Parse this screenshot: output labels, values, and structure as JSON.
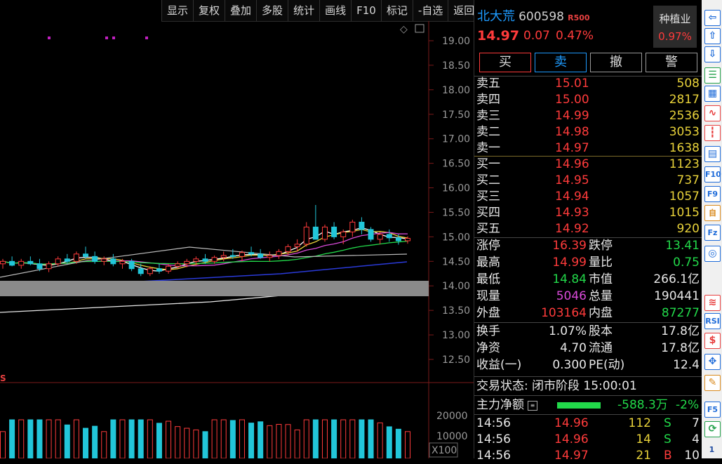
{
  "toolbar": {
    "items": [
      "显示",
      "复权",
      "叠加",
      "多股",
      "统计",
      "画线",
      "F10",
      "标记",
      "-自选",
      "返回"
    ]
  },
  "chart": {
    "y_ticks": [
      "19.00",
      "18.50",
      "18.00",
      "17.50",
      "17.00",
      "16.50",
      "16.00",
      "15.50",
      "15.00",
      "14.50",
      "14.00",
      "13.50",
      "13.00",
      "12.50"
    ],
    "vol_ticks": [
      "20000",
      "10000"
    ],
    "vol_unit": "X100",
    "s_marker": "S"
  },
  "chart_data": {
    "type": "candlestick",
    "price_range": [
      12.5,
      19.0
    ],
    "volume_range": [
      0,
      25000
    ],
    "candles": [
      [
        14.45,
        14.55,
        14.35,
        14.5
      ],
      [
        14.5,
        14.6,
        14.4,
        14.42
      ],
      [
        14.42,
        14.55,
        14.35,
        14.5
      ],
      [
        14.5,
        14.6,
        14.42,
        14.45
      ],
      [
        14.45,
        14.55,
        14.3,
        14.35
      ],
      [
        14.35,
        14.5,
        14.28,
        14.45
      ],
      [
        14.45,
        14.6,
        14.4,
        14.55
      ],
      [
        14.55,
        14.65,
        14.45,
        14.5
      ],
      [
        14.5,
        14.7,
        14.45,
        14.65
      ],
      [
        14.65,
        14.8,
        14.55,
        14.6
      ],
      [
        14.6,
        14.7,
        14.45,
        14.5
      ],
      [
        14.5,
        14.6,
        14.42,
        14.55
      ],
      [
        14.55,
        14.65,
        14.4,
        14.45
      ],
      [
        14.45,
        14.55,
        14.35,
        14.5
      ],
      [
        14.5,
        14.55,
        14.3,
        14.35
      ],
      [
        14.35,
        14.45,
        14.2,
        14.25
      ],
      [
        14.25,
        14.4,
        14.2,
        14.35
      ],
      [
        14.35,
        14.45,
        14.25,
        14.3
      ],
      [
        14.3,
        14.45,
        14.25,
        14.4
      ],
      [
        14.4,
        14.5,
        14.35,
        14.45
      ],
      [
        14.45,
        14.55,
        14.38,
        14.5
      ],
      [
        14.5,
        14.6,
        14.42,
        14.55
      ],
      [
        14.55,
        14.65,
        14.45,
        14.5
      ],
      [
        14.5,
        14.62,
        14.45,
        14.58
      ],
      [
        14.58,
        14.7,
        14.5,
        14.62
      ],
      [
        14.62,
        14.75,
        14.55,
        14.6
      ],
      [
        14.6,
        14.72,
        14.5,
        14.68
      ],
      [
        14.68,
        14.8,
        14.6,
        14.65
      ],
      [
        14.65,
        14.75,
        14.55,
        14.58
      ],
      [
        14.58,
        14.7,
        14.5,
        14.62
      ],
      [
        14.62,
        14.75,
        14.55,
        14.7
      ],
      [
        14.7,
        14.85,
        14.62,
        14.8
      ],
      [
        14.8,
        14.95,
        14.7,
        14.85
      ],
      [
        14.85,
        15.3,
        14.8,
        15.2
      ],
      [
        15.2,
        15.65,
        15.0,
        14.95
      ],
      [
        14.95,
        15.25,
        14.9,
        15.2
      ],
      [
        15.2,
        15.3,
        14.95,
        15.0
      ],
      [
        15.0,
        15.15,
        14.85,
        15.1
      ],
      [
        15.1,
        15.35,
        15.0,
        15.3
      ],
      [
        15.3,
        15.4,
        15.05,
        15.15
      ],
      [
        15.15,
        15.2,
        14.9,
        14.95
      ],
      [
        14.95,
        15.1,
        14.85,
        15.05
      ],
      [
        15.05,
        15.15,
        14.9,
        14.98
      ],
      [
        14.98,
        15.05,
        14.84,
        14.92
      ],
      [
        14.92,
        15.01,
        14.86,
        14.97
      ]
    ]
  },
  "quote": {
    "name": "北大荒",
    "code": "600598",
    "badge": "R500",
    "price": "14.97",
    "change": "0.07",
    "change_pct": "0.47%",
    "sector": "种植业",
    "sector_pct": "0.97%",
    "buttons": {
      "buy": "买",
      "sell": "卖",
      "cancel": "撤",
      "alert": "警"
    }
  },
  "orderbook": {
    "asks": [
      {
        "label": "卖五",
        "price": "15.01",
        "vol": "508"
      },
      {
        "label": "卖四",
        "price": "15.00",
        "vol": "2817"
      },
      {
        "label": "卖三",
        "price": "14.99",
        "vol": "2536"
      },
      {
        "label": "卖二",
        "price": "14.98",
        "vol": "3053"
      },
      {
        "label": "卖一",
        "price": "14.97",
        "vol": "1638"
      }
    ],
    "bids": [
      {
        "label": "买一",
        "price": "14.96",
        "vol": "1123"
      },
      {
        "label": "买二",
        "price": "14.95",
        "vol": "737"
      },
      {
        "label": "买三",
        "price": "14.94",
        "vol": "1057"
      },
      {
        "label": "买四",
        "price": "14.93",
        "vol": "1015"
      },
      {
        "label": "买五",
        "price": "14.92",
        "vol": "920"
      }
    ]
  },
  "stats": [
    {
      "l1": "涨停",
      "v1": "16.39",
      "l2": "跌停",
      "v2": "13.41"
    },
    {
      "l1": "最高",
      "v1": "14.99",
      "l2": "量比",
      "v2": "0.75"
    },
    {
      "l1": "最低",
      "v1": "14.84",
      "l2": "市值",
      "v2": "266.1亿"
    },
    {
      "l1": "现量",
      "v1": "5046",
      "l2": "总量",
      "v2": "190441"
    },
    {
      "l1": "外盘",
      "v1": "103164",
      "l2": "内盘",
      "v2": "87277"
    }
  ],
  "stats2": [
    {
      "l1": "换手",
      "v1": "1.07%",
      "l2": "股本",
      "v2": "17.8亿"
    },
    {
      "l1": "净资",
      "v1": "4.70",
      "l2": "流通",
      "v2": "17.8亿"
    },
    {
      "l1": "收益(一)",
      "v1": "0.300",
      "l2": "PE(动)",
      "v2": "12.4"
    }
  ],
  "status": {
    "label": "交易状态:",
    "value": "闭市阶段 15:00:01"
  },
  "flow": {
    "label": "主力净额",
    "value": "-588.3万",
    "pct": "-2%"
  },
  "trades": [
    {
      "time": "14:56",
      "price": "14.96",
      "vol": "112",
      "side": "S",
      "n": "7"
    },
    {
      "time": "14:56",
      "price": "14.96",
      "vol": "14",
      "side": "S",
      "n": "4"
    },
    {
      "time": "14:56",
      "price": "14.97",
      "vol": "21",
      "side": "B",
      "n": "10"
    }
  ],
  "sidebar": {
    "icons": [
      "left-arrow-icon",
      "up-arrow-icon",
      "down-arrow-icon",
      "list-icon",
      "grid-icon",
      "line-chart-icon",
      "candle-icon",
      "doc-icon",
      "f10-icon",
      "f9-icon",
      "self-icon",
      "fz-icon",
      "circle-icon",
      "macd-icon",
      "rsi-icon",
      "money-icon",
      "move-icon",
      "pen-icon",
      "f5-icon",
      "refresh-icon"
    ],
    "labels": {
      "f10": "F10",
      "f9": "F9",
      "self": "自",
      "fz": "Fz",
      "rsi": "RSI",
      "f5": "F5",
      "page": "1"
    }
  }
}
